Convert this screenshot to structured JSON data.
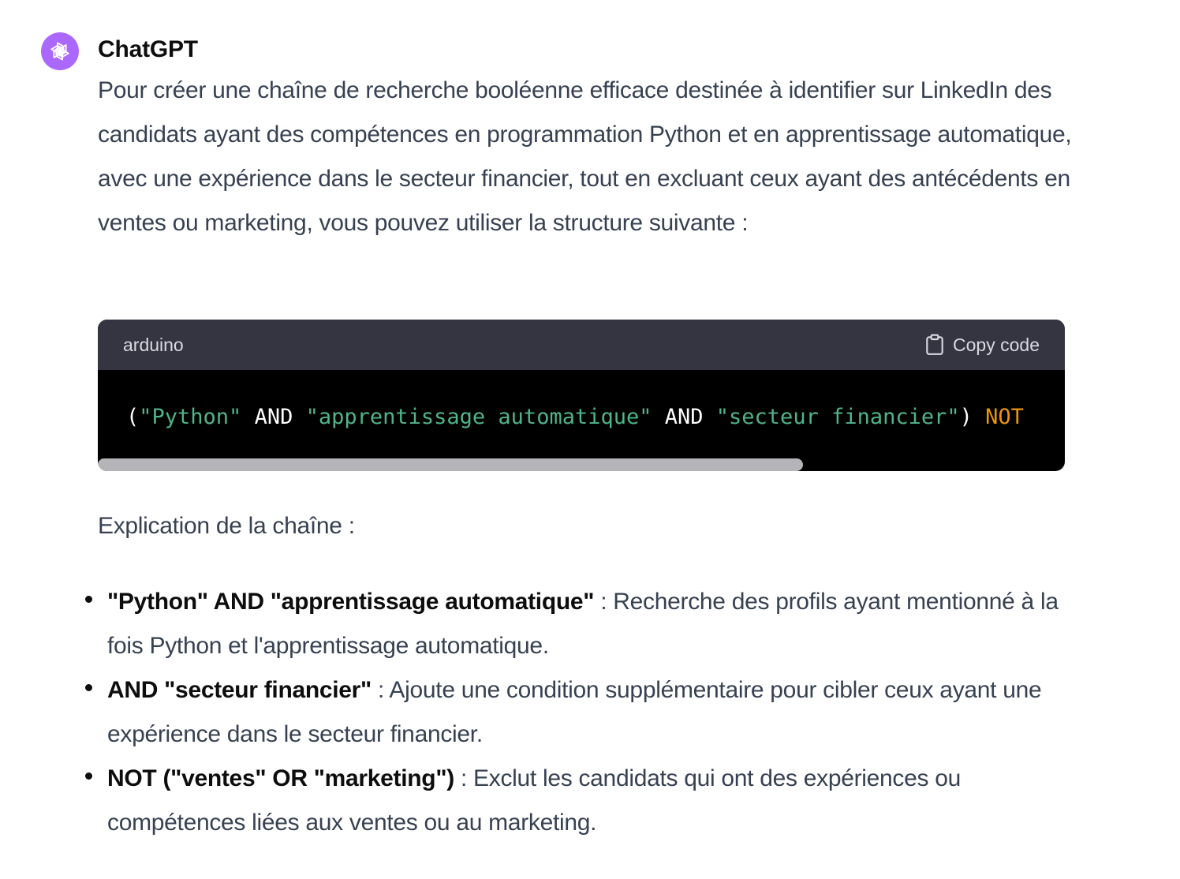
{
  "message": {
    "author": "ChatGPT",
    "avatar_icon": "openai-logo-icon",
    "avatar_color": "#ab68ff",
    "intro": "Pour créer une chaîne de recherche booléenne efficace destinée à identifier sur LinkedIn des candidats ayant des compétences en programmation Python et en apprentissage automatique, avec une expérience dans le secteur financier, tout en excluant ceux ayant des antécédents en ventes ou marketing, vous pouvez utiliser la structure suivante :",
    "code_block": {
      "language": "arduino",
      "copy_label": "Copy code",
      "copy_icon": "clipboard-icon",
      "tokens": [
        {
          "text": "(",
          "type": "punc"
        },
        {
          "text": "\"Python\"",
          "type": "str"
        },
        {
          "text": " AND ",
          "type": "kw"
        },
        {
          "text": "\"apprentissage automatique\"",
          "type": "str"
        },
        {
          "text": " AND ",
          "type": "kw"
        },
        {
          "text": "\"secteur financier\"",
          "type": "str"
        },
        {
          "text": ") ",
          "type": "punc"
        },
        {
          "text": "NOT",
          "type": "not"
        }
      ],
      "scroll_position": 0,
      "scroll_visible_fraction": 0.73
    },
    "explanation_heading": "Explication de la chaîne :",
    "bullets": [
      {
        "term": "\"Python\" AND \"apprentissage automatique\"",
        "desc": " : Recherche des profils ayant mentionné à la fois Python et l'apprentissage automatique."
      },
      {
        "term": "AND \"secteur financier\"",
        "desc": " : Ajoute une condition supplémentaire pour cibler ceux ayant une expérience dans le secteur financier."
      },
      {
        "term": "NOT (\"ventes\" OR \"marketing\")",
        "desc": " : Exclut les candidats qui ont des expériences ou compétences liées aux ventes ou au marketing."
      }
    ]
  }
}
